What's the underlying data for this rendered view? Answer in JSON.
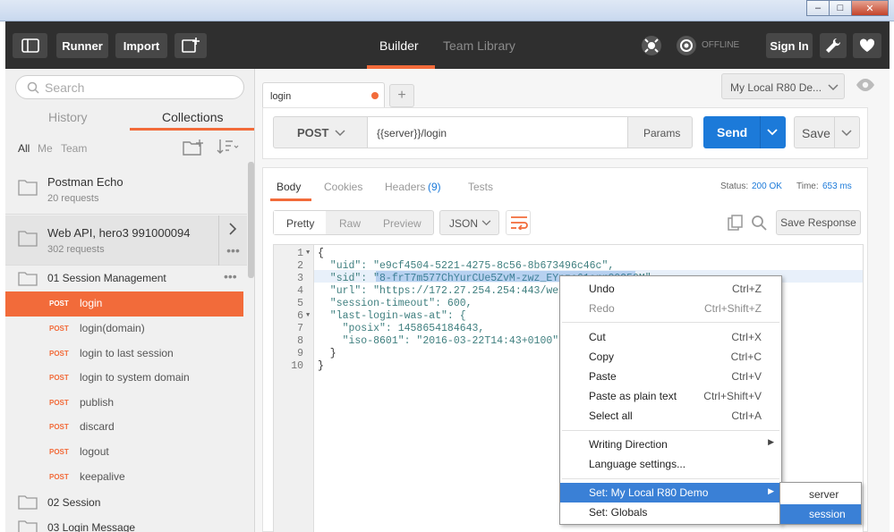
{
  "window": {
    "buttons": [
      "minimize",
      "maximize",
      "close"
    ]
  },
  "header": {
    "runner": "Runner",
    "import": "Import",
    "tabs": [
      "Builder",
      "Team Library"
    ],
    "status": "OFFLINE",
    "signin": "Sign In"
  },
  "sidebar": {
    "search_placeholder": "Search",
    "tabs": [
      "History",
      "Collections"
    ],
    "filters": [
      "All",
      "Me",
      "Team"
    ],
    "collections": [
      {
        "name": "Postman Echo",
        "count": "20 requests"
      },
      {
        "name": "Web API, hero3 991000094",
        "count": "302 requests"
      }
    ],
    "folders": [
      "01 Session Management",
      "02 Session",
      "03 Login Message"
    ],
    "requests": [
      {
        "method": "POST",
        "name": "login"
      },
      {
        "method": "POST",
        "name": "login(domain)"
      },
      {
        "method": "POST",
        "name": "login to last session"
      },
      {
        "method": "POST",
        "name": "login to system domain"
      },
      {
        "method": "POST",
        "name": "publish"
      },
      {
        "method": "POST",
        "name": "discard"
      },
      {
        "method": "POST",
        "name": "logout"
      },
      {
        "method": "POST",
        "name": "keepalive"
      }
    ]
  },
  "request": {
    "tab_name": "login",
    "environment": "My Local R80 De...",
    "method": "POST",
    "url": "{{server}}/login",
    "params": "Params",
    "send": "Send",
    "save": "Save"
  },
  "response": {
    "tabs": [
      "Body",
      "Cookies",
      "Headers",
      "Tests"
    ],
    "headers_count": "(9)",
    "status_label": "Status:",
    "status_value": "200 OK",
    "time_label": "Time:",
    "time_value": "653 ms",
    "views": [
      "Pretty",
      "Raw",
      "Preview"
    ],
    "format": "JSON",
    "save_response": "Save Response",
    "line_numbers": [
      "1",
      "2",
      "3",
      "4",
      "5",
      "6",
      "7",
      "8",
      "9",
      "10"
    ],
    "lines": [
      "{",
      "  \"uid\": \"e9cf4504-5221-4275-8c56-8b673496c46c\",",
      "  \"sid\": \"8-frT7m577ChYurCUe5ZvM-zwz_EYnzc61orrC0Q50M\",",
      "  \"url\": \"https://172.27.254.254:443/web_",
      "  \"session-timeout\": 600,",
      "  \"last-login-was-at\": {",
      "    \"posix\": 1458654184643,",
      "    \"iso-8601\": \"2016-03-22T14:43+0100\"",
      "  }",
      "}"
    ]
  },
  "context_menu": {
    "items": [
      {
        "label": "Undo",
        "shortcut": "Ctrl+Z"
      },
      {
        "label": "Redo",
        "shortcut": "Ctrl+Shift+Z"
      },
      {
        "label": "Cut",
        "shortcut": "Ctrl+X"
      },
      {
        "label": "Copy",
        "shortcut": "Ctrl+C"
      },
      {
        "label": "Paste",
        "shortcut": "Ctrl+V"
      },
      {
        "label": "Paste as plain text",
        "shortcut": "Ctrl+Shift+V"
      },
      {
        "label": "Select all",
        "shortcut": "Ctrl+A"
      },
      {
        "label": "Writing Direction",
        "shortcut": ""
      },
      {
        "label": "Language settings...",
        "shortcut": ""
      },
      {
        "label": "Set: My Local R80 Demo",
        "shortcut": ""
      },
      {
        "label": "Set: Globals",
        "shortcut": ""
      }
    ],
    "submenu": [
      "server",
      "session"
    ]
  },
  "colors": {
    "accent": "#f26b3a",
    "send": "#1c7ad9",
    "header": "#2f2f2f",
    "highlight": "#3a80d6"
  }
}
